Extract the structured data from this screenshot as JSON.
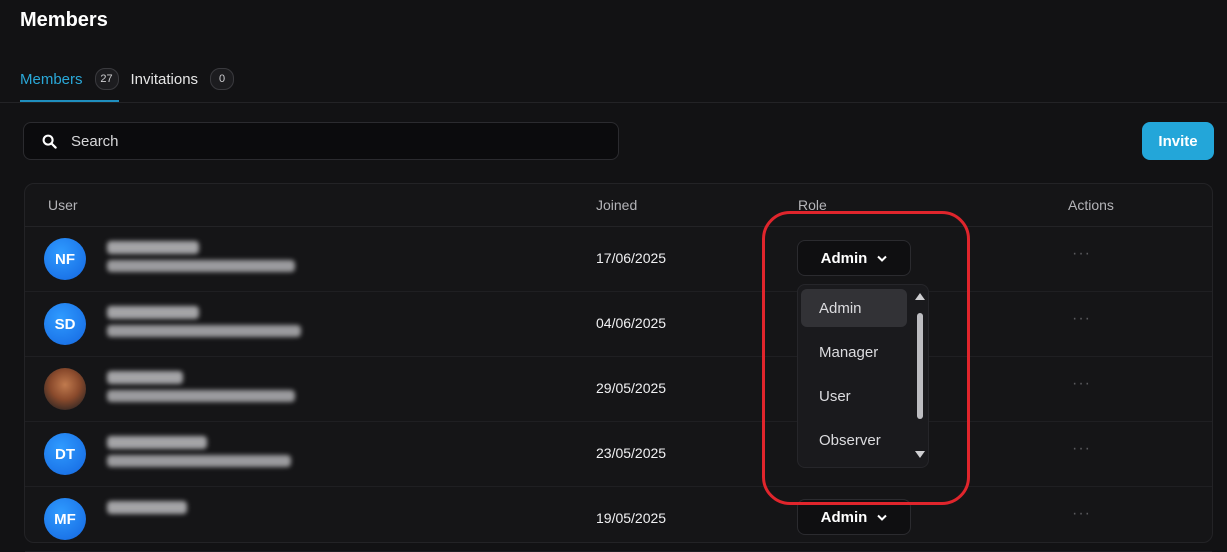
{
  "page": {
    "title": "Members"
  },
  "tabs": [
    {
      "label": "Members",
      "count": "27",
      "active": true
    },
    {
      "label": "Invitations",
      "count": "0",
      "active": false
    }
  ],
  "search": {
    "placeholder": "Search",
    "value": ""
  },
  "invite_button": {
    "label": "Invite"
  },
  "table": {
    "columns": {
      "user": "User",
      "joined": "Joined",
      "role": "Role",
      "actions": "Actions"
    },
    "rows": [
      {
        "initials": "NF",
        "joined": "17/06/2025",
        "role": "Admin"
      },
      {
        "initials": "SD",
        "joined": "04/06/2025",
        "role": ""
      },
      {
        "initials": "",
        "joined": "29/05/2025",
        "role": ""
      },
      {
        "initials": "DT",
        "joined": "23/05/2025",
        "role": ""
      },
      {
        "initials": "MF",
        "joined": "19/05/2025",
        "role": "Admin"
      }
    ],
    "actions_glyph": "···"
  },
  "role_dropdown": {
    "options": [
      "Admin",
      "Manager",
      "User",
      "Observer"
    ],
    "selected": "Admin"
  },
  "colors": {
    "accent": "#23a6d9",
    "highlight": "#e0252c",
    "background": "#121214"
  }
}
